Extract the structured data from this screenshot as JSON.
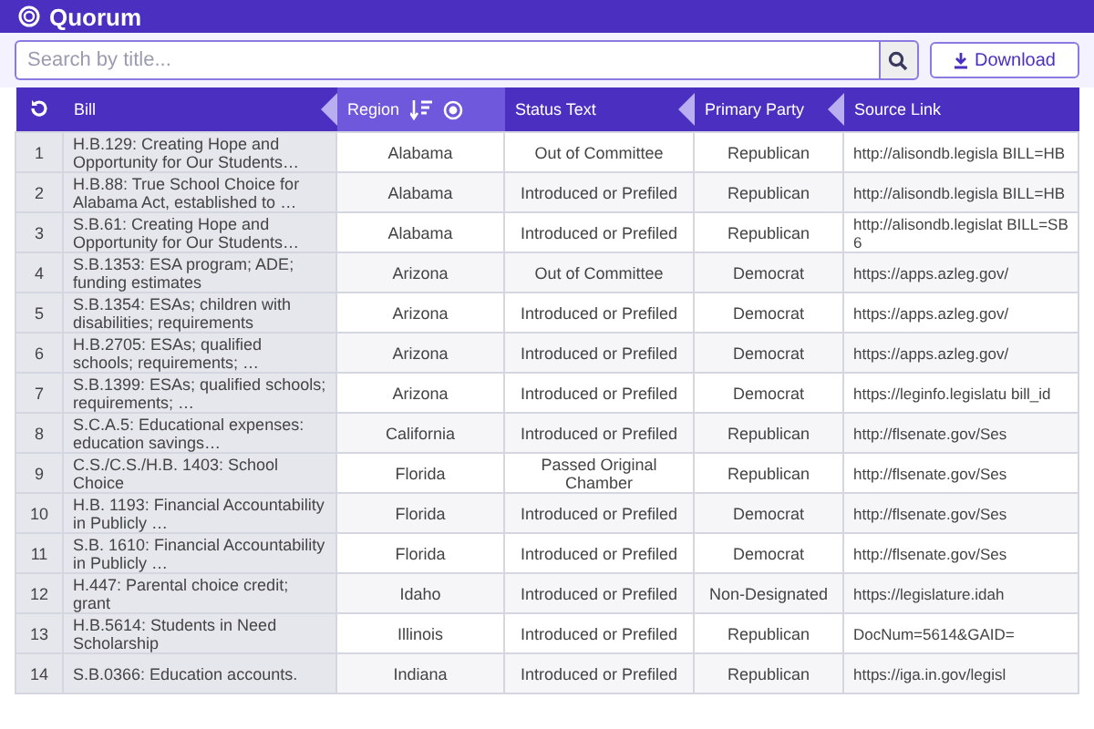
{
  "app": {
    "logo": "Quorum"
  },
  "search": {
    "placeholder": "Search by title..."
  },
  "download_button": "Download",
  "table": {
    "columns": [
      {
        "label": "Bill",
        "sorted": false,
        "collapse_marker": true
      },
      {
        "label": "Region",
        "sorted": true,
        "collapse_marker": false
      },
      {
        "label": "Status Text",
        "sorted": false,
        "collapse_marker": true
      },
      {
        "label": "Primary Party",
        "sorted": false,
        "collapse_marker": true
      },
      {
        "label": "Source Link",
        "sorted": false,
        "collapse_marker": false
      }
    ],
    "rows": [
      {
        "index": "1",
        "cells": [
          "H.B.129: Creating Hope and Opportunity for Our Students…",
          "Alabama",
          "Out of Committee",
          "Republican",
          "http://alisondb.legisla BILL=HB"
        ]
      },
      {
        "index": "2",
        "cells": [
          "H.B.88: True School Choice for Alabama Act, established to …",
          "Alabama",
          "Introduced or Prefiled",
          "Republican",
          "http://alisondb.legisla BILL=HB"
        ]
      },
      {
        "index": "3",
        "cells": [
          "S.B.61: Creating Hope and Opportunity for Our Students…",
          "Alabama",
          "Introduced or Prefiled",
          "Republican",
          "http://alisondb.legislat BILL=SB6"
        ]
      },
      {
        "index": "4",
        "cells": [
          "S.B.1353: ESA program; ADE; funding estimates",
          "Arizona",
          "Out of Committee",
          "Democrat",
          "https://apps.azleg.gov/"
        ]
      },
      {
        "index": "5",
        "cells": [
          "S.B.1354: ESAs; children with disabilities; requirements",
          "Arizona",
          "Introduced or Prefiled",
          "Democrat",
          "https://apps.azleg.gov/"
        ]
      },
      {
        "index": "6",
        "cells": [
          "H.B.2705: ESAs; qualified schools; requirements; …",
          "Arizona",
          "Introduced or Prefiled",
          "Democrat",
          "https://apps.azleg.gov/"
        ]
      },
      {
        "index": "7",
        "cells": [
          "S.B.1399: ESAs; qualified schools; requirements; …",
          "Arizona",
          "Introduced or Prefiled",
          "Democrat",
          "https://leginfo.legislatu bill_id"
        ]
      },
      {
        "index": "8",
        "cells": [
          "S.C.A.5: Educational expenses: education savings…",
          "California",
          "Introduced or Prefiled",
          "Republican",
          "http://flsenate.gov/Ses"
        ]
      },
      {
        "index": "9",
        "cells": [
          "C.S./C.S./H.B. 1403: School Choice",
          "Florida",
          "Passed Original Chamber",
          "Republican",
          "http://flsenate.gov/Ses"
        ]
      },
      {
        "index": "10",
        "cells": [
          "H.B. 1193: Financial Accountability in Publicly …",
          "Florida",
          "Introduced or Prefiled",
          "Democrat",
          "http://flsenate.gov/Ses"
        ]
      },
      {
        "index": "11",
        "cells": [
          "S.B. 1610: Financial Accountability in Publicly …",
          "Florida",
          "Introduced or Prefiled",
          "Democrat",
          "http://flsenate.gov/Ses"
        ]
      },
      {
        "index": "12",
        "cells": [
          "H.447: Parental choice credit; grant",
          "Idaho",
          "Introduced or Prefiled",
          "Non-Designated",
          "https://legislature.idah"
        ]
      },
      {
        "index": "13",
        "cells": [
          "H.B.5614: Students in Need Scholarship",
          "Illinois",
          "Introduced or Prefiled",
          "Republican",
          "DocNum=5614&GAID="
        ]
      },
      {
        "index": "14",
        "cells": [
          "S.B.0366: Education accounts.",
          "Indiana",
          "Introduced or Prefiled",
          "Republican",
          "https://iga.in.gov/legisl"
        ]
      }
    ]
  }
}
